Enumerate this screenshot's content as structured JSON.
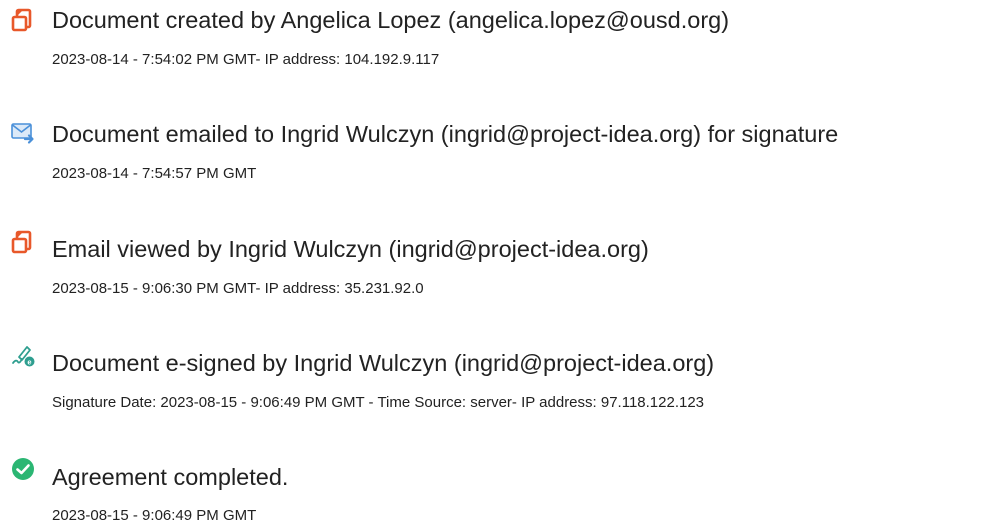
{
  "events": [
    {
      "icon": "document-created-icon",
      "title": "Document created by Angelica Lopez (angelica.lopez@ousd.org)",
      "meta": "2023-08-14 - 7:54:02 PM GMT- IP address: 104.192.9.117"
    },
    {
      "icon": "email-sent-icon",
      "title": "Document emailed to Ingrid Wulczyn (ingrid@project-idea.org) for signature",
      "meta": "2023-08-14 - 7:54:57 PM GMT"
    },
    {
      "icon": "document-viewed-icon",
      "title": "Email viewed by Ingrid Wulczyn (ingrid@project-idea.org)",
      "meta": "2023-08-15 - 9:06:30 PM GMT- IP address: 35.231.92.0"
    },
    {
      "icon": "esign-icon",
      "title": "Document e-signed by Ingrid Wulczyn (ingrid@project-idea.org)",
      "meta": "Signature Date: 2023-08-15 - 9:06:49 PM GMT - Time Source: server- IP address: 97.118.122.123"
    },
    {
      "icon": "checkmark-circle-icon",
      "title": "Agreement completed.",
      "meta": "2023-08-15 - 9:06:49 PM GMT"
    }
  ],
  "colors": {
    "doc_icon": "#e8582a",
    "email_icon": "#4a90d9",
    "sign_icon": "#2e9e8f",
    "check_icon": "#2bb673"
  }
}
